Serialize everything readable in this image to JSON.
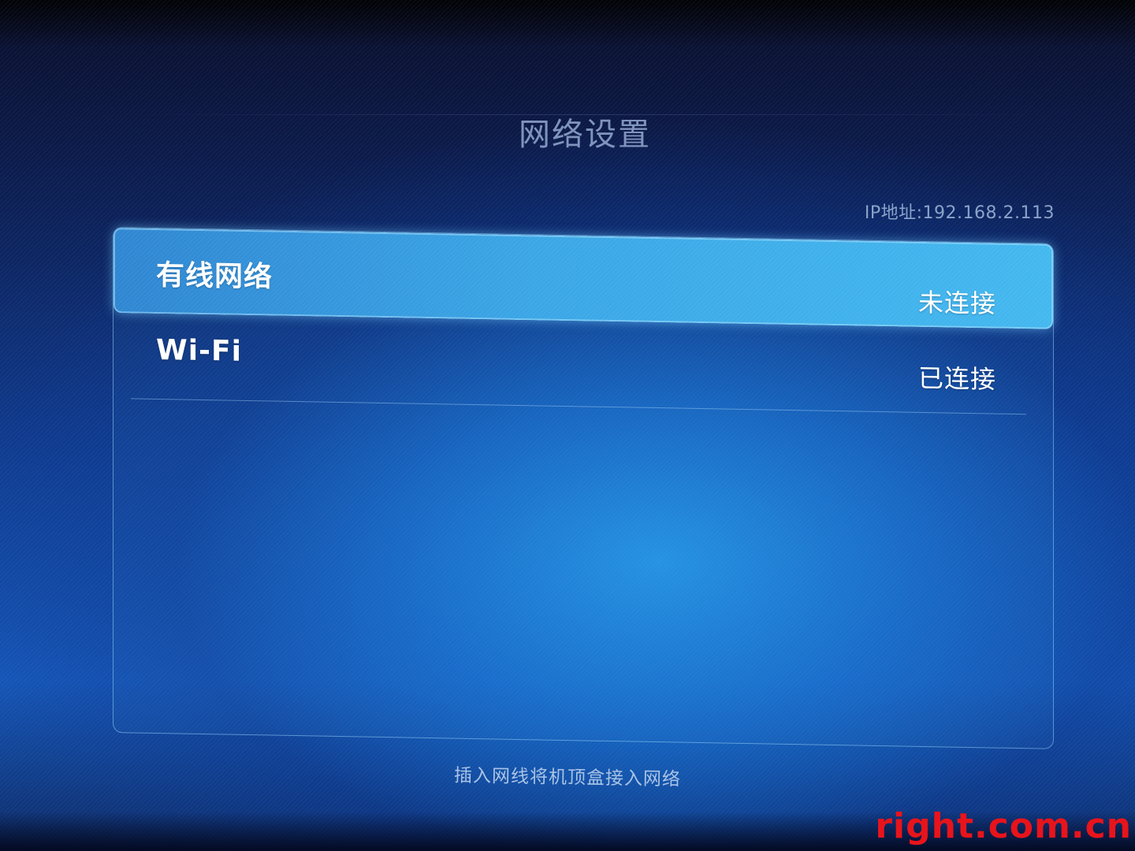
{
  "header": {
    "title": "网络设置",
    "ip_address": "IP地址:192.168.2.113"
  },
  "network_list": {
    "items": [
      {
        "label": "有线网络",
        "status": "未连接",
        "selected": true
      },
      {
        "label": "Wi-Fi",
        "status": "已连接",
        "selected": false
      }
    ]
  },
  "footer": {
    "hint": "插入网线将机顶盒接入网络"
  },
  "watermark": {
    "text": "right.com.cn"
  },
  "colors": {
    "background_center": "#2496e6",
    "selected_row": "#3aa6e6",
    "text_primary": "#ffffff",
    "title_text": "#7f94bd",
    "watermark": "#e8141b"
  }
}
